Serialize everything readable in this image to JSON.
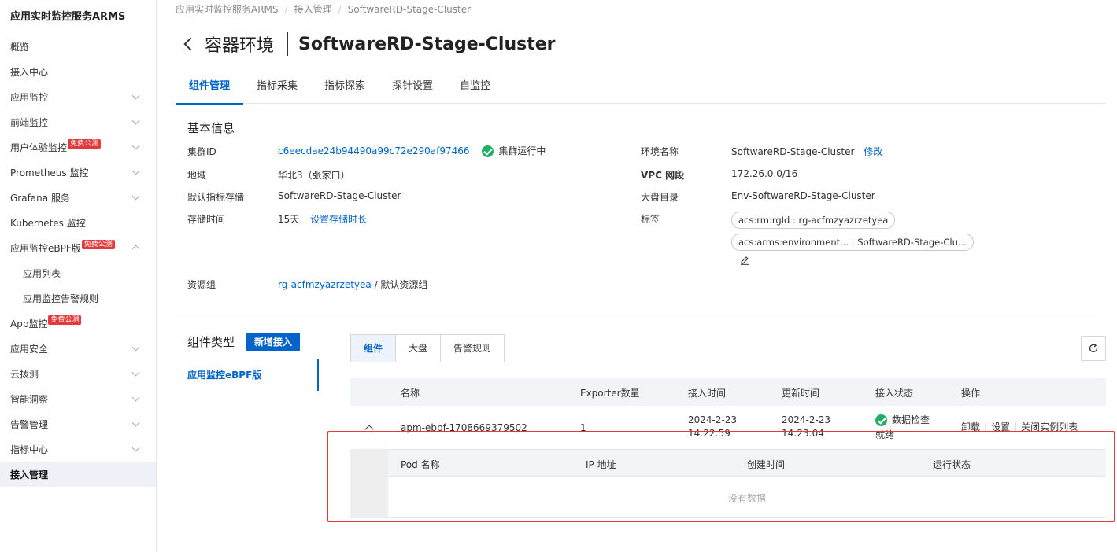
{
  "sidebar": {
    "title": "应用实时监控服务ARMS",
    "items": [
      {
        "label": "概览",
        "chevron": false
      },
      {
        "label": "接入中心",
        "chevron": false
      },
      {
        "label": "应用监控",
        "chevron": true
      },
      {
        "label": "前端监控",
        "chevron": true
      },
      {
        "label": "用户体验监控",
        "badge": "免费公测",
        "chevron": true
      },
      {
        "label": "Prometheus 监控",
        "chevron": true
      },
      {
        "label": "Grafana 服务",
        "chevron": true
      },
      {
        "label": "Kubernetes 监控",
        "chevron": false
      },
      {
        "label": "应用监控eBPF版",
        "badge": "免费公测",
        "chevron": true,
        "expanded": true
      },
      {
        "label": "应用列表",
        "sub": true
      },
      {
        "label": "应用监控告警规则",
        "sub": true
      },
      {
        "label": "App监控",
        "badge": "免费公测",
        "chevron": false
      },
      {
        "label": "应用安全",
        "chevron": true
      },
      {
        "label": "云拨测",
        "chevron": true
      },
      {
        "label": "智能洞察",
        "chevron": true
      },
      {
        "label": "告警管理",
        "chevron": true
      },
      {
        "label": "指标中心",
        "chevron": true
      },
      {
        "label": "接入管理",
        "active": true
      }
    ]
  },
  "breadcrumb": [
    "应用实时监控服务ARMS",
    "接入管理",
    "SoftwareRD-Stage-Cluster"
  ],
  "page": {
    "title": "容器环境",
    "cluster_name": "SoftwareRD-Stage-Cluster"
  },
  "tabs": [
    "组件管理",
    "指标采集",
    "指标探索",
    "探针设置",
    "自监控"
  ],
  "basic_info": {
    "title": "基本信息",
    "cluster_id_label": "集群ID",
    "cluster_id": "c6eecdae24b94490a99c72e290af97466",
    "cluster_status": "集群运行中",
    "region_label": "地域",
    "region": "华北3（张家口）",
    "default_storage_label": "默认指标存储",
    "default_storage": "SoftwareRD-Stage-Cluster",
    "retention_label": "存储时间",
    "retention": "15天",
    "retention_link": "设置存储时长",
    "env_name_label": "环境名称",
    "env_name": "SoftwareRD-Stage-Cluster",
    "env_name_edit": "修改",
    "vpc_label": "VPC 网段",
    "vpc": "172.26.0.0/16",
    "dashboard_label": "大盘目录",
    "dashboard": "Env-SoftwareRD-Stage-Cluster",
    "tags_label": "标签",
    "tags": [
      "acs:rm:rgId : rg-acfmzyazrzetyea",
      "acs:arms:environment... : SoftwareRD-Stage-Clu..."
    ],
    "resource_group_label": "资源组",
    "resource_group_id": "rg-acfmzyazrzetyea",
    "resource_group_name": " / 默认资源组"
  },
  "components": {
    "title": "组件类型",
    "add_button": "新增接入",
    "nav_item": "应用监控eBPF版",
    "segments": [
      "组件",
      "大盘",
      "告警规则"
    ],
    "table_headers": [
      "名称",
      "Exporter数量",
      "接入时间",
      "更新时间",
      "接入状态",
      "操作"
    ],
    "row": {
      "name": "apm-ebpf-1708669379502",
      "exporter_count": "1",
      "access_date": "2024-2-23",
      "access_time": "14:22:59",
      "update_date": "2024-2-23",
      "update_time": "14:23:04",
      "status_line1": "数据检查",
      "status_line2": "就绪",
      "ops": [
        "卸载",
        "设置",
        "关闭实例列表"
      ]
    },
    "sub_headers": [
      "Pod 名称",
      "IP 地址",
      "创建时间",
      "运行状态"
    ],
    "empty_text": "没有数据"
  },
  "colors": {
    "primary": "#0064c8",
    "success": "#23b066",
    "badge": "#e5383b",
    "highlight": "#e53935"
  }
}
